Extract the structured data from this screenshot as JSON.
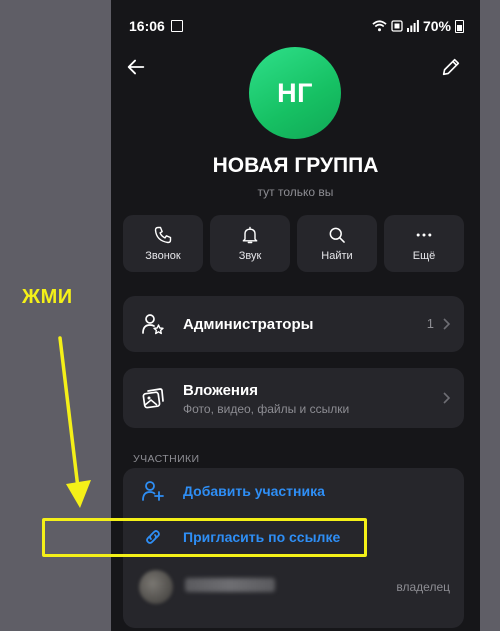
{
  "status_bar": {
    "time": "16:06",
    "battery": "70%"
  },
  "header": {
    "avatar_initials": "НГ",
    "title": "НОВАЯ ГРУППА",
    "subtitle": "тут только вы"
  },
  "actions": [
    {
      "label": "Звонок",
      "icon": "phone-icon"
    },
    {
      "label": "Звук",
      "icon": "bell-icon"
    },
    {
      "label": "Найти",
      "icon": "search-icon"
    },
    {
      "label": "Ещё",
      "icon": "more-icon"
    }
  ],
  "admins": {
    "title": "Администраторы",
    "count": "1"
  },
  "attachments": {
    "title": "Вложения",
    "subtitle": "Фото, видео, файлы и ссылки"
  },
  "members": {
    "section_label": "УЧАСТНИКИ",
    "add_label": "Добавить участника",
    "invite_label": "Пригласить по ссылке",
    "owner_role": "владелец"
  },
  "annotation": {
    "text": "ЖМИ",
    "color": "#f4f018"
  },
  "colors": {
    "accent": "#2e8ef5",
    "avatar": "#16c063",
    "background": "#161619",
    "card": "#26262b"
  }
}
